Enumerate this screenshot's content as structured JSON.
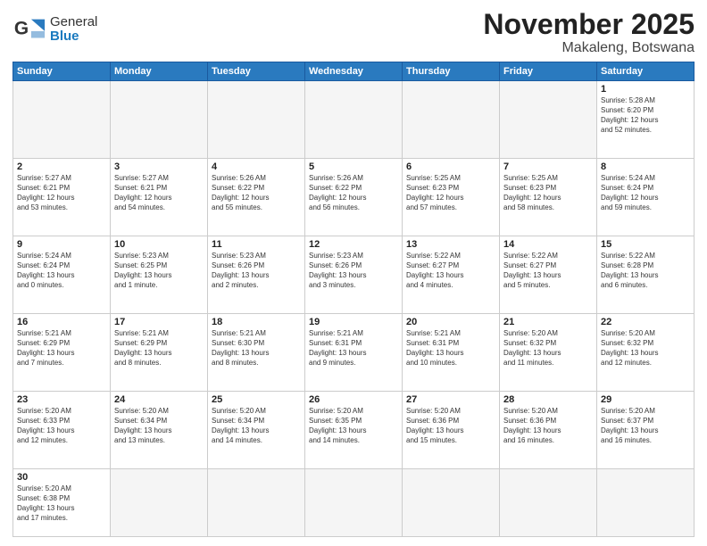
{
  "logo": {
    "general": "General",
    "blue": "Blue"
  },
  "title": "November 2025",
  "subtitle": "Makaleng, Botswana",
  "days_of_week": [
    "Sunday",
    "Monday",
    "Tuesday",
    "Wednesday",
    "Thursday",
    "Friday",
    "Saturday"
  ],
  "weeks": [
    [
      {
        "day": "",
        "info": "",
        "empty": true
      },
      {
        "day": "",
        "info": "",
        "empty": true
      },
      {
        "day": "",
        "info": "",
        "empty": true
      },
      {
        "day": "",
        "info": "",
        "empty": true
      },
      {
        "day": "",
        "info": "",
        "empty": true
      },
      {
        "day": "",
        "info": "",
        "empty": true
      },
      {
        "day": "1",
        "info": "Sunrise: 5:28 AM\nSunset: 6:20 PM\nDaylight: 12 hours\nand 52 minutes."
      }
    ],
    [
      {
        "day": "2",
        "info": "Sunrise: 5:27 AM\nSunset: 6:21 PM\nDaylight: 12 hours\nand 53 minutes."
      },
      {
        "day": "3",
        "info": "Sunrise: 5:27 AM\nSunset: 6:21 PM\nDaylight: 12 hours\nand 54 minutes."
      },
      {
        "day": "4",
        "info": "Sunrise: 5:26 AM\nSunset: 6:22 PM\nDaylight: 12 hours\nand 55 minutes."
      },
      {
        "day": "5",
        "info": "Sunrise: 5:26 AM\nSunset: 6:22 PM\nDaylight: 12 hours\nand 56 minutes."
      },
      {
        "day": "6",
        "info": "Sunrise: 5:25 AM\nSunset: 6:23 PM\nDaylight: 12 hours\nand 57 minutes."
      },
      {
        "day": "7",
        "info": "Sunrise: 5:25 AM\nSunset: 6:23 PM\nDaylight: 12 hours\nand 58 minutes."
      },
      {
        "day": "8",
        "info": "Sunrise: 5:24 AM\nSunset: 6:24 PM\nDaylight: 12 hours\nand 59 minutes."
      }
    ],
    [
      {
        "day": "9",
        "info": "Sunrise: 5:24 AM\nSunset: 6:24 PM\nDaylight: 13 hours\nand 0 minutes."
      },
      {
        "day": "10",
        "info": "Sunrise: 5:23 AM\nSunset: 6:25 PM\nDaylight: 13 hours\nand 1 minute."
      },
      {
        "day": "11",
        "info": "Sunrise: 5:23 AM\nSunset: 6:26 PM\nDaylight: 13 hours\nand 2 minutes."
      },
      {
        "day": "12",
        "info": "Sunrise: 5:23 AM\nSunset: 6:26 PM\nDaylight: 13 hours\nand 3 minutes."
      },
      {
        "day": "13",
        "info": "Sunrise: 5:22 AM\nSunset: 6:27 PM\nDaylight: 13 hours\nand 4 minutes."
      },
      {
        "day": "14",
        "info": "Sunrise: 5:22 AM\nSunset: 6:27 PM\nDaylight: 13 hours\nand 5 minutes."
      },
      {
        "day": "15",
        "info": "Sunrise: 5:22 AM\nSunset: 6:28 PM\nDaylight: 13 hours\nand 6 minutes."
      }
    ],
    [
      {
        "day": "16",
        "info": "Sunrise: 5:21 AM\nSunset: 6:29 PM\nDaylight: 13 hours\nand 7 minutes."
      },
      {
        "day": "17",
        "info": "Sunrise: 5:21 AM\nSunset: 6:29 PM\nDaylight: 13 hours\nand 8 minutes."
      },
      {
        "day": "18",
        "info": "Sunrise: 5:21 AM\nSunset: 6:30 PM\nDaylight: 13 hours\nand 8 minutes."
      },
      {
        "day": "19",
        "info": "Sunrise: 5:21 AM\nSunset: 6:31 PM\nDaylight: 13 hours\nand 9 minutes."
      },
      {
        "day": "20",
        "info": "Sunrise: 5:21 AM\nSunset: 6:31 PM\nDaylight: 13 hours\nand 10 minutes."
      },
      {
        "day": "21",
        "info": "Sunrise: 5:20 AM\nSunset: 6:32 PM\nDaylight: 13 hours\nand 11 minutes."
      },
      {
        "day": "22",
        "info": "Sunrise: 5:20 AM\nSunset: 6:32 PM\nDaylight: 13 hours\nand 12 minutes."
      }
    ],
    [
      {
        "day": "23",
        "info": "Sunrise: 5:20 AM\nSunset: 6:33 PM\nDaylight: 13 hours\nand 12 minutes."
      },
      {
        "day": "24",
        "info": "Sunrise: 5:20 AM\nSunset: 6:34 PM\nDaylight: 13 hours\nand 13 minutes."
      },
      {
        "day": "25",
        "info": "Sunrise: 5:20 AM\nSunset: 6:34 PM\nDaylight: 13 hours\nand 14 minutes."
      },
      {
        "day": "26",
        "info": "Sunrise: 5:20 AM\nSunset: 6:35 PM\nDaylight: 13 hours\nand 14 minutes."
      },
      {
        "day": "27",
        "info": "Sunrise: 5:20 AM\nSunset: 6:36 PM\nDaylight: 13 hours\nand 15 minutes."
      },
      {
        "day": "28",
        "info": "Sunrise: 5:20 AM\nSunset: 6:36 PM\nDaylight: 13 hours\nand 16 minutes."
      },
      {
        "day": "29",
        "info": "Sunrise: 5:20 AM\nSunset: 6:37 PM\nDaylight: 13 hours\nand 16 minutes."
      }
    ],
    [
      {
        "day": "30",
        "info": "Sunrise: 5:20 AM\nSunset: 6:38 PM\nDaylight: 13 hours\nand 17 minutes.",
        "last": true
      },
      {
        "day": "",
        "info": "",
        "empty": true,
        "last": true
      },
      {
        "day": "",
        "info": "",
        "empty": true,
        "last": true
      },
      {
        "day": "",
        "info": "",
        "empty": true,
        "last": true
      },
      {
        "day": "",
        "info": "",
        "empty": true,
        "last": true
      },
      {
        "day": "",
        "info": "",
        "empty": true,
        "last": true
      },
      {
        "day": "",
        "info": "",
        "empty": true,
        "last": true
      }
    ]
  ]
}
